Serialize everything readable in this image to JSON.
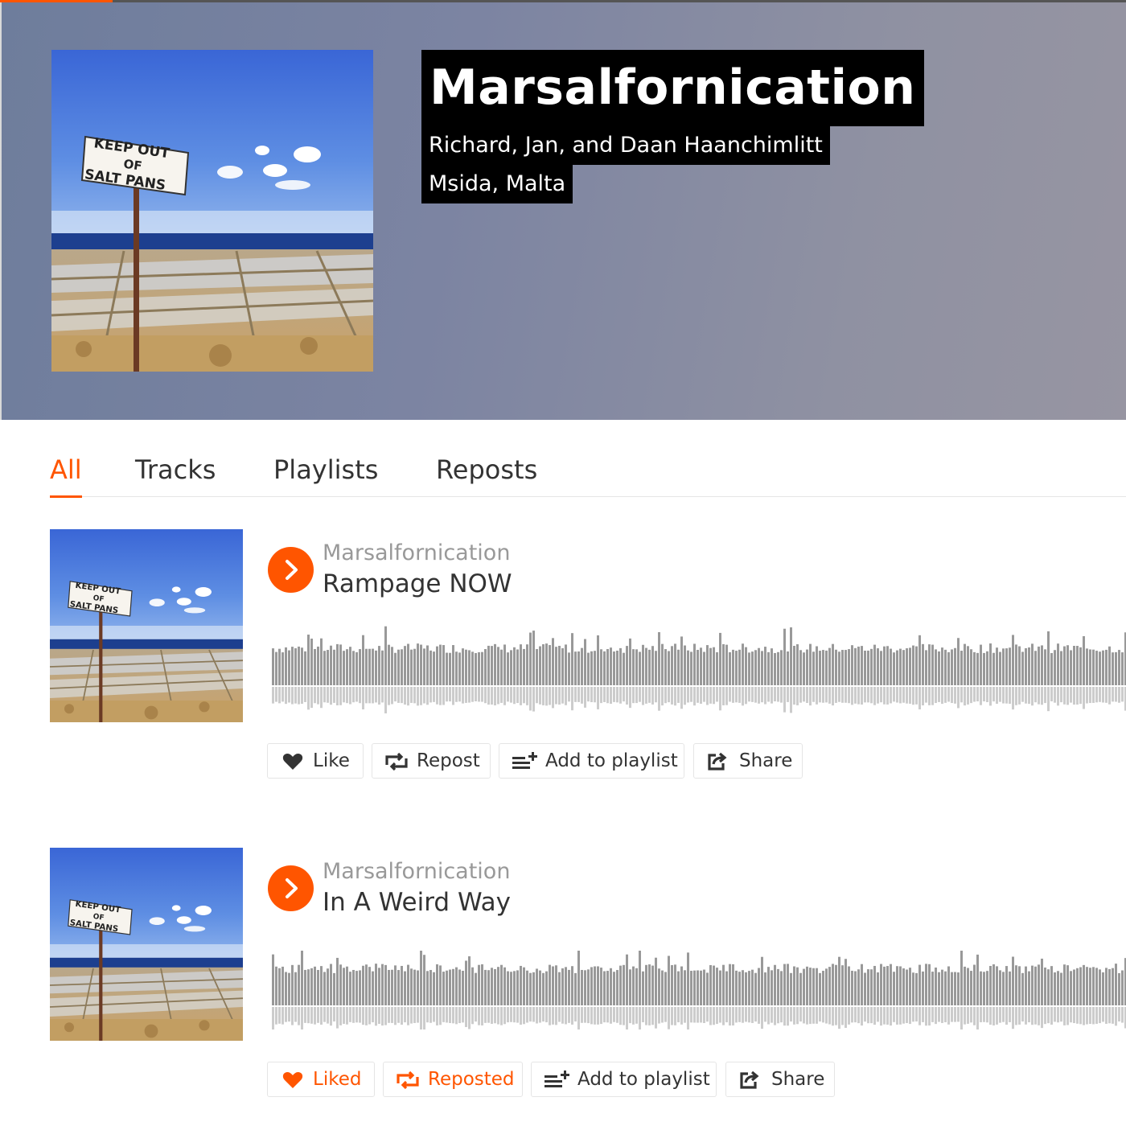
{
  "profile": {
    "name": "Marsalfornication",
    "full_name": "Richard, Jan, and Daan Haanchimlitt",
    "location": "Msida, Malta",
    "artwork_sign": [
      "KEEP OUT",
      "OF",
      "SALT PANS"
    ]
  },
  "tabs": [
    {
      "label": "All",
      "active": true
    },
    {
      "label": "Tracks",
      "active": false
    },
    {
      "label": "Playlists",
      "active": false
    },
    {
      "label": "Reposts",
      "active": false
    }
  ],
  "tracks": [
    {
      "artist": "Marsalfornication",
      "title": "Rampage NOW",
      "actions": {
        "like": {
          "label": "Like",
          "active": false
        },
        "repost": {
          "label": "Repost",
          "active": false
        },
        "add": {
          "label": "Add to playlist"
        },
        "share": {
          "label": "Share"
        }
      }
    },
    {
      "artist": "Marsalfornication",
      "title": "In A Weird Way",
      "actions": {
        "like": {
          "label": "Liked",
          "active": true
        },
        "repost": {
          "label": "Reposted",
          "active": true
        },
        "add": {
          "label": "Add to playlist"
        },
        "share": {
          "label": "Share"
        }
      }
    }
  ],
  "colors": {
    "accent": "#ff5500",
    "text": "#333333",
    "muted": "#999999",
    "waveform": "#999999",
    "waveform_reflection": "#cccccc"
  },
  "icons": {
    "play": "play-icon",
    "like": "heart-icon",
    "repost": "repost-icon",
    "add_to_playlist": "add-to-playlist-icon",
    "share": "share-icon"
  }
}
